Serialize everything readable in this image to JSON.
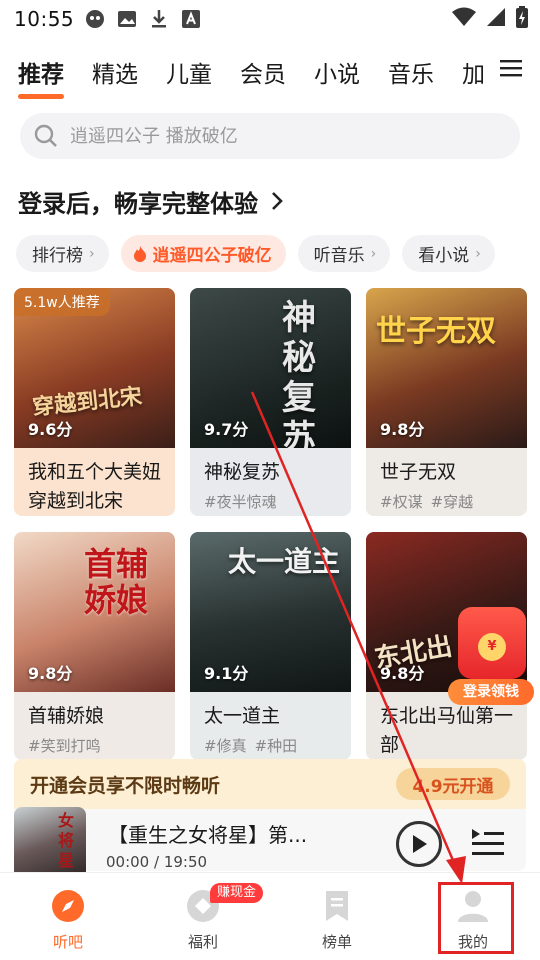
{
  "status_bar": {
    "time": "10:55"
  },
  "tabs": [
    {
      "label": "推荐",
      "active": true
    },
    {
      "label": "精选"
    },
    {
      "label": "儿童"
    },
    {
      "label": "会员"
    },
    {
      "label": "小说"
    },
    {
      "label": "音乐"
    },
    {
      "label": "加"
    }
  ],
  "search": {
    "placeholder": "逍遥四公子 播放破亿"
  },
  "login_prompt": "登录后，畅享完整体验",
  "chips": [
    {
      "label": "排行榜",
      "chevron": "›"
    },
    {
      "label": "逍遥四公子破亿",
      "hot": true
    },
    {
      "label": "听音乐",
      "chevron": "›"
    },
    {
      "label": "看小说",
      "chevron": "›"
    }
  ],
  "books": [
    {
      "title": "我和五个大美妞穿越到北宋",
      "score": "9.6分",
      "badge": "5.1w人推荐",
      "tags": [],
      "cover_text": "穿越到北宋"
    },
    {
      "title": "神秘复苏",
      "score": "9.7分",
      "tags": [
        "#夜半惊魂"
      ],
      "cover_text": "神秘复苏"
    },
    {
      "title": "世子无双",
      "score": "9.8分",
      "tags": [
        "#权谋",
        "#穿越"
      ],
      "cover_text": "世子无双"
    },
    {
      "title": "首辅娇娘",
      "score": "9.8分",
      "tags": [
        "#笑到打鸣"
      ],
      "cover_text": "首辅娇娘"
    },
    {
      "title": "太一道主",
      "score": "9.1分",
      "tags": [
        "#修真",
        "#种田"
      ],
      "cover_text": "太一道主"
    },
    {
      "title": "东北出马仙第一部",
      "score": "9.8分",
      "tags": [],
      "cover_text": "东北出"
    }
  ],
  "envelope": {
    "label": "登录领钱",
    "coin": "¥"
  },
  "vip": {
    "text": "开通会员享不限时畅听",
    "button": "4.9元开通"
  },
  "player": {
    "title": "【重生之女将星】第...",
    "time": "00:00 / 19:50",
    "cover_text": "女将星"
  },
  "bottom_nav": [
    {
      "label": "听吧",
      "icon": "compass-icon",
      "active": true
    },
    {
      "label": "福利",
      "icon": "gift-icon",
      "badge": "赚现金"
    },
    {
      "label": "榜单",
      "icon": "bookmark-icon"
    },
    {
      "label": "我的",
      "icon": "person-icon"
    }
  ],
  "colors": {
    "accent": "#ff6a2b",
    "annotation": "#e02424"
  }
}
